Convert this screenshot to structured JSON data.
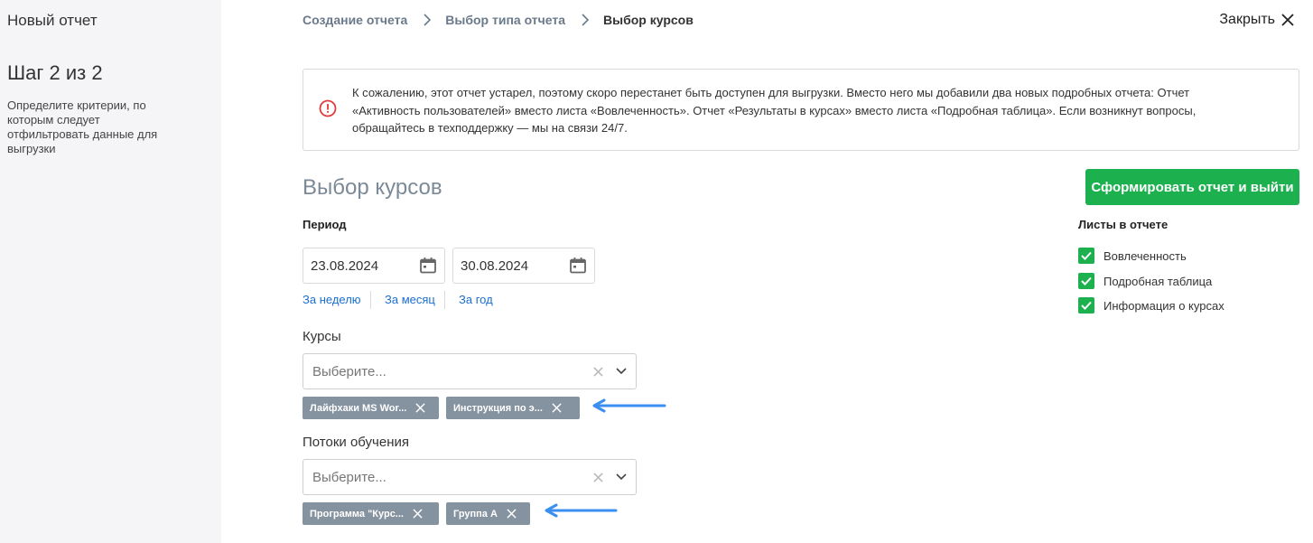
{
  "sidebar": {
    "title": "Новый отчет",
    "step": "Шаг 2 из 2",
    "description": "Определите критерии, по которым следует отфильтровать данные для выгрузки"
  },
  "breadcrumb": {
    "items": [
      "Создание отчета",
      "Выбор типа отчета"
    ],
    "current": "Выбор курсов"
  },
  "header": {
    "close_label": "Закрыть"
  },
  "alert": {
    "text": "К сожалению, этот отчет устарел, поэтому скоро перестанет быть доступен для выгрузки. Вместо него мы добавили два новых подробных отчета: Отчет «Активность пользователей» вместо листа «Вовлеченность». Отчет «Результаты в курсах» вместо листа «Подробная таблица». Если возникнут вопросы, обращайтесь в техподдержку — мы на связи 24/7.",
    "icon": "warning-circle-icon",
    "color": "#e03a3a"
  },
  "main": {
    "title": "Выбор курсов",
    "generate_button": "Сформировать отчет и выйти",
    "period_label": "Период",
    "date_from": "23.08.2024",
    "date_to": "30.08.2024",
    "quick_ranges": [
      "За неделю",
      "За месяц",
      "За год"
    ],
    "courses": {
      "label": "Курсы",
      "placeholder": "Выберите...",
      "selected": [
        "Лайфхаки MS Wor...",
        "Инструкция по э..."
      ]
    },
    "streams": {
      "label": "Потоки обучения",
      "placeholder": "Выберите...",
      "selected": [
        "Программа \"Курс...",
        "Группа А"
      ]
    }
  },
  "sheets": {
    "label": "Листы в отчете",
    "items": [
      {
        "label": "Вовлеченность",
        "checked": true
      },
      {
        "label": "Подробная таблица",
        "checked": true
      },
      {
        "label": "Информация о курсах",
        "checked": true
      }
    ]
  },
  "colors": {
    "accent_green": "#1cb04f",
    "link_blue": "#1a6fd0",
    "chip_gray": "#8592a0",
    "annotation_arrow": "#3a8ff0"
  }
}
